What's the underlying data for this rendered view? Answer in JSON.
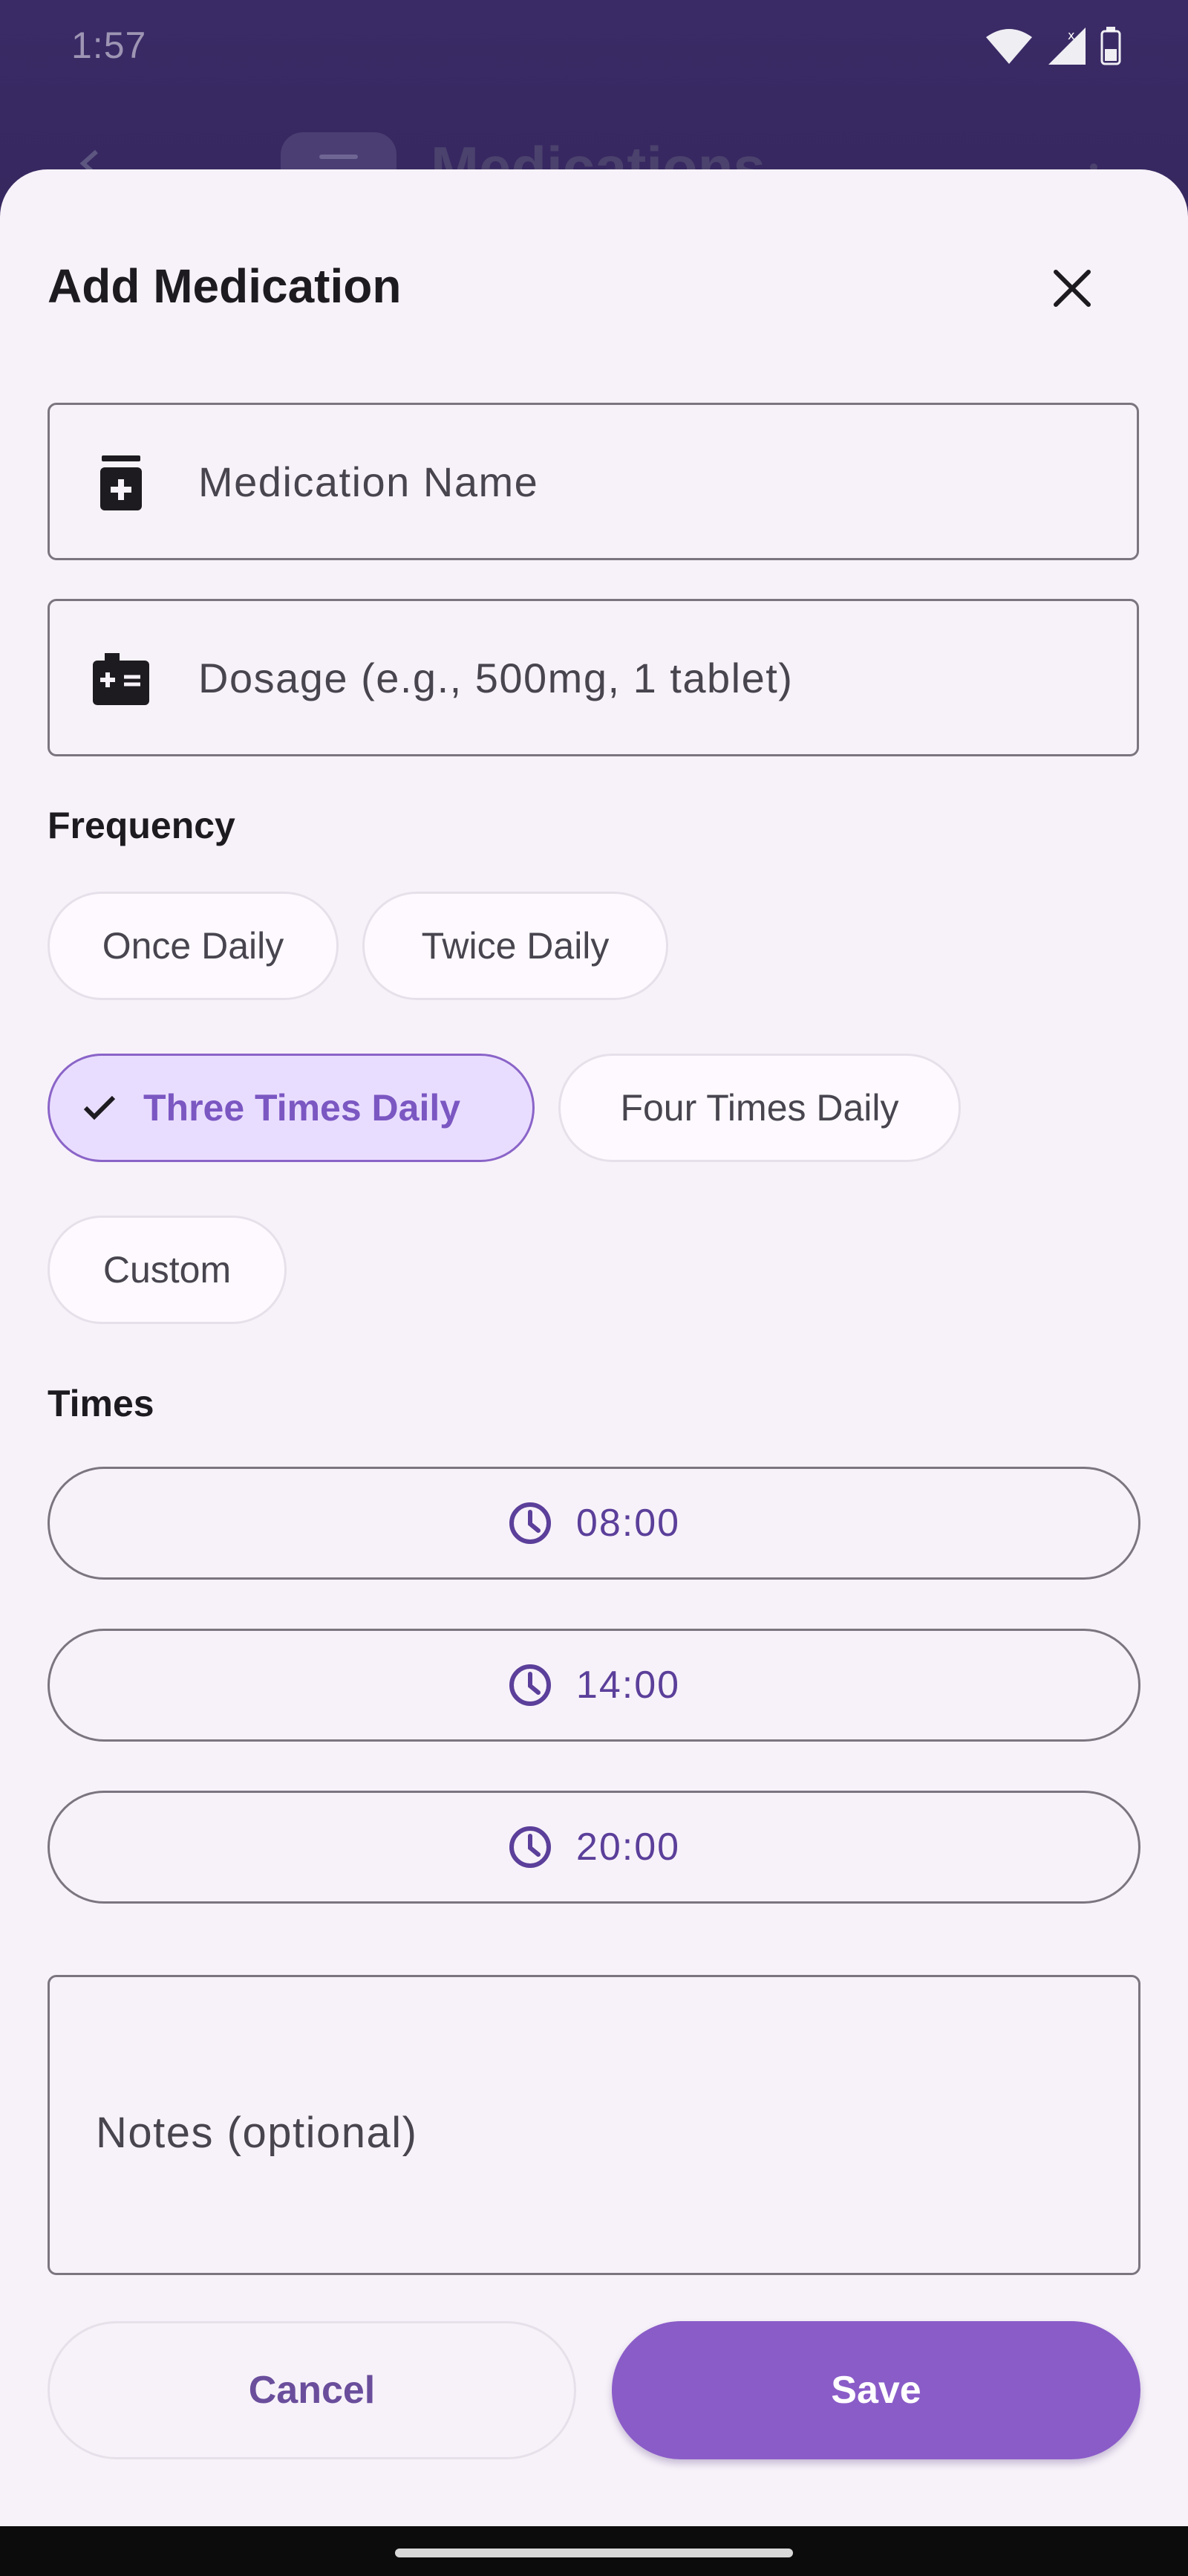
{
  "status_bar": {
    "time": "1:57",
    "icons": [
      "wifi-icon",
      "signal-icon",
      "battery-icon"
    ]
  },
  "background_app": {
    "title": "Medications"
  },
  "sheet": {
    "title": "Add Medication",
    "close_icon": "close-icon",
    "fields": {
      "medication_name": {
        "placeholder": "Medication Name",
        "value": "",
        "icon": "medication-bottle-icon"
      },
      "dosage": {
        "placeholder": "Dosage (e.g., 500mg, 1 tablet)",
        "value": "",
        "icon": "medical-kit-icon"
      },
      "notes": {
        "placeholder": "Notes (optional)",
        "value": ""
      }
    },
    "frequency": {
      "label": "Frequency",
      "options": [
        {
          "label": "Once Daily",
          "selected": false
        },
        {
          "label": "Twice Daily",
          "selected": false
        },
        {
          "label": "Three Times Daily",
          "selected": true
        },
        {
          "label": "Four Times Daily",
          "selected": false
        },
        {
          "label": "Custom",
          "selected": false
        }
      ]
    },
    "times": {
      "label": "Times",
      "entries": [
        "08:00",
        "14:00",
        "20:00"
      ]
    },
    "actions": {
      "cancel": "Cancel",
      "save": "Save"
    }
  },
  "colors": {
    "accent": "#8a5cc8",
    "chip_selected_bg": "#e9ddff",
    "chip_selected_text": "#7b57c2",
    "time_text": "#5b3f9a",
    "sheet_bg": "#f7f2f9"
  }
}
